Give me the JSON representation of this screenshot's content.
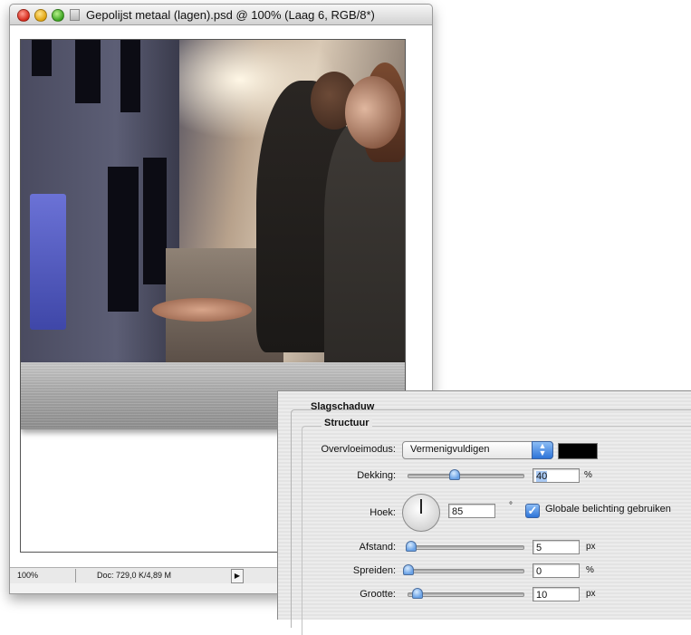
{
  "window": {
    "title": "Gepolijst metaal (lagen).psd @ 100% (Laag 6, RGB/8*)",
    "zoom": "100%",
    "doc_info": "Doc: 729,0 K/4,89 M"
  },
  "panel": {
    "section": "Slagschaduw",
    "subsection": "Structuur",
    "blend_mode_label": "Overvloeimodus:",
    "blend_mode_value": "Vermenigvuldigen",
    "shadow_color": "#000000",
    "opacity_label": "Dekking:",
    "opacity_value": "40",
    "opacity_unit": "%",
    "opacity_level": 40,
    "angle_label": "Hoek:",
    "angle_value": "85",
    "angle_unit": "°",
    "global_light_label": "Globale belichting gebruiken",
    "global_light_checked": true,
    "distance_label": "Afstand:",
    "distance_value": "5",
    "distance_unit": "px",
    "spread_label": "Spreiden:",
    "spread_value": "0",
    "spread_unit": "%",
    "size_label": "Grootte:",
    "size_value": "10",
    "size_unit": "px"
  },
  "icons": {
    "close": "close-icon",
    "minimize": "minimize-icon",
    "zoom": "zoom-icon",
    "proxy": "document-proxy-icon",
    "status_menu": "triangle-right-icon"
  }
}
